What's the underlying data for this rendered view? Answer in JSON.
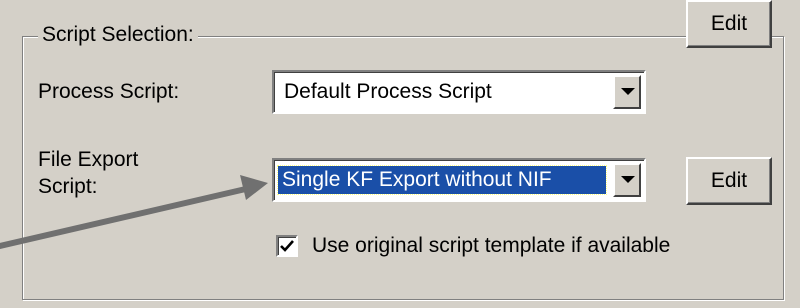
{
  "group": {
    "legend": "Script Selection:"
  },
  "process_script": {
    "label": "Process Script:",
    "selected_value": "Default Process Script",
    "edit_label": "Edit"
  },
  "file_export_script": {
    "label": "File Export Script:",
    "selected_value": "Single KF Export without NIF",
    "edit_label": "Edit"
  },
  "use_template": {
    "checked": true,
    "label": "Use original script template if available"
  },
  "icons": {
    "dropdown": "chevron-down-icon",
    "checkmark": "checkmark-icon",
    "annotation": "arrow-pointer-icon"
  },
  "colors": {
    "background": "#d4d0c8",
    "selection": "#1a4fa8",
    "arrow": "#707070"
  }
}
